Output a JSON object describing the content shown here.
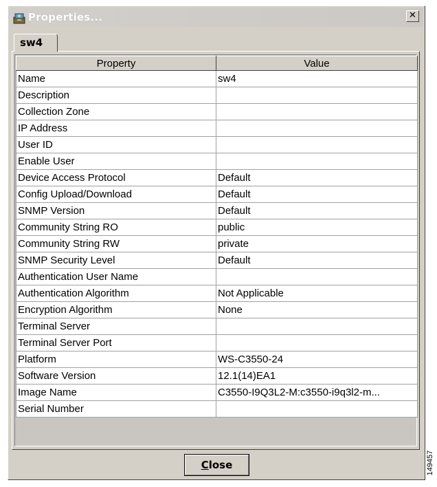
{
  "window": {
    "title": "Properties...",
    "close_glyph": "✕"
  },
  "tab": {
    "label": "sw4"
  },
  "table": {
    "headers": [
      "Property",
      "Value"
    ],
    "rows": [
      [
        "Name",
        "sw4"
      ],
      [
        "Description",
        ""
      ],
      [
        "Collection Zone",
        ""
      ],
      [
        "IP Address",
        ""
      ],
      [
        "User ID",
        ""
      ],
      [
        "Enable User",
        ""
      ],
      [
        "Device Access Protocol",
        "Default"
      ],
      [
        "Config Upload/Download",
        "Default"
      ],
      [
        "SNMP Version",
        "Default"
      ],
      [
        "Community String RO",
        "public"
      ],
      [
        "Community String RW",
        "private"
      ],
      [
        "SNMP Security Level",
        "Default"
      ],
      [
        "Authentication User Name",
        ""
      ],
      [
        "Authentication Algorithm",
        "Not Applicable"
      ],
      [
        "Encryption Algorithm",
        "None"
      ],
      [
        "Terminal Server",
        ""
      ],
      [
        "Terminal Server Port",
        ""
      ],
      [
        "Platform",
        "WS-C3550-24"
      ],
      [
        "Software Version",
        "12.1(14)EA1"
      ],
      [
        "Image Name",
        "C3550-I9Q3L2-M:c3550-i9q3l2-m..."
      ],
      [
        "Serial Number",
        ""
      ]
    ]
  },
  "buttons": {
    "close_first": "C",
    "close_rest": "lose"
  },
  "side_label": "149457",
  "icons": {
    "title_icon": "properties-app-icon",
    "close_icon": "close-icon"
  }
}
